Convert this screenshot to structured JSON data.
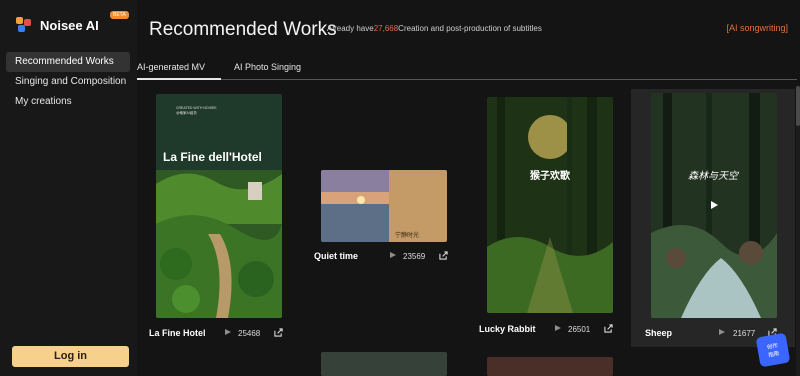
{
  "app": {
    "name": "Noisee AI",
    "beta": "BETA"
  },
  "sidebar": {
    "items": [
      {
        "label": "Recommended Works"
      },
      {
        "label": "Singing and Composition"
      },
      {
        "label": "My creations"
      }
    ],
    "login_label": "Log in"
  },
  "header": {
    "title": "Recommended Works",
    "stats_prefix": "Already have",
    "stats_number": "27,668",
    "stats_suffix": "Creation and post-production of subtitles",
    "link": "[AI songwriting]"
  },
  "tabs": [
    {
      "label": "AI-generated MV",
      "active": true
    },
    {
      "label": "AI Photo Singing",
      "active": false
    }
  ],
  "cards": [
    {
      "title": "La Fine Hotel",
      "plays": "25468",
      "thumb_text": "La Fine dell'Hotel",
      "thumb_brand": "CREATED WITH NOISEE",
      "thumb_brand_sub": "@俺家AI组务"
    },
    {
      "title": "Quiet time",
      "plays": "23569",
      "thumb_text": "宁静时光"
    },
    {
      "title": "Lucky Rabbit",
      "plays": "26501",
      "thumb_text": "猴子欢歌"
    },
    {
      "title": "Sheep",
      "plays": "21677",
      "thumb_text": "森林与天空"
    }
  ],
  "badge": {
    "line1": "创作",
    "line2": "指南"
  },
  "colors": {
    "accent": "#e6703a",
    "login_bg": "#f7d08b",
    "stats_number": "#e8684f"
  },
  "icons": {
    "play": "play-icon",
    "share": "share-icon",
    "logo": "noisee-logo-icon"
  }
}
